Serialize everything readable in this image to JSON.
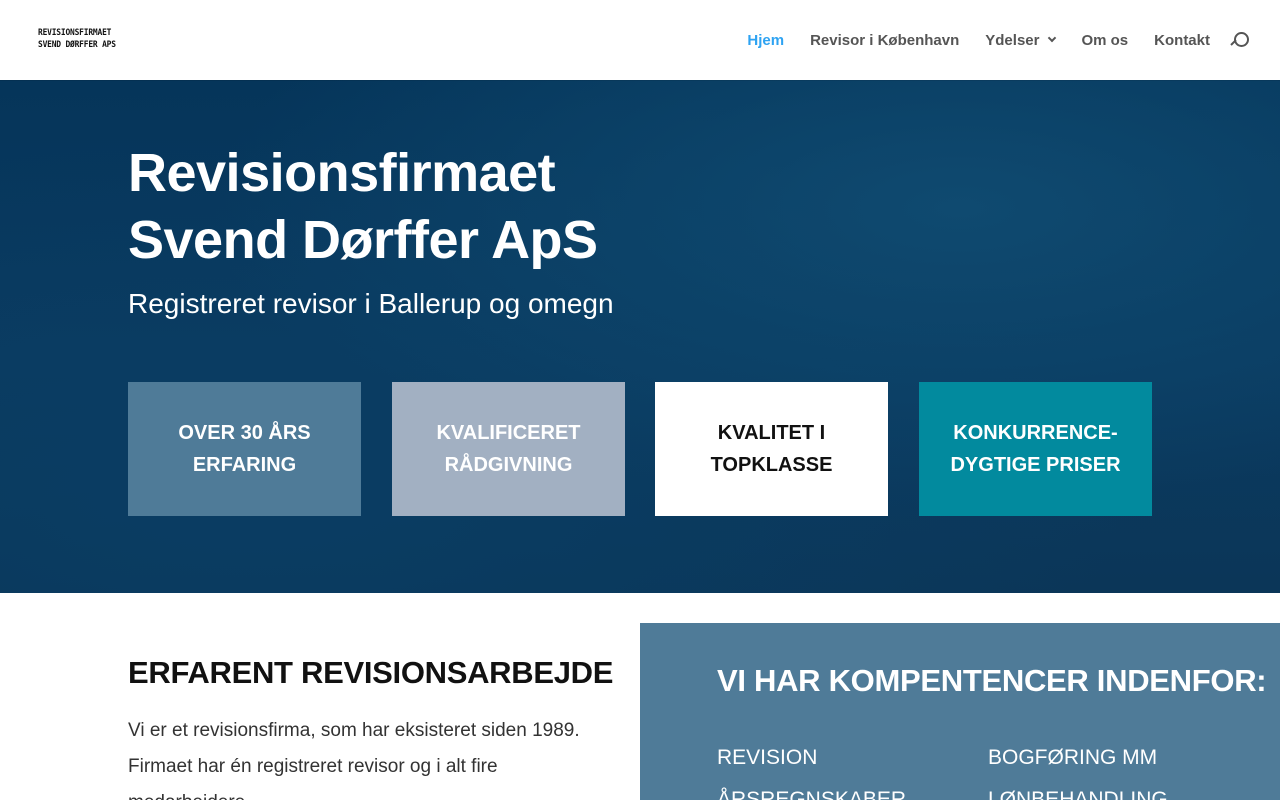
{
  "logo": {
    "line1": "REVISIONSFIRMAET",
    "line2": "SVEND DØRFFER APS"
  },
  "nav": {
    "items": [
      {
        "label": "Hjem"
      },
      {
        "label": "Revisor i København"
      },
      {
        "label": "Ydelser"
      },
      {
        "label": "Om os"
      },
      {
        "label": "Kontakt"
      }
    ]
  },
  "hero": {
    "title_line1": "Revisionsfirmaet",
    "title_line2": "Svend Dørffer ApS",
    "subtitle": "Registreret revisor i Ballerup og omegn",
    "features": [
      {
        "line1": "OVER 30 ÅRS",
        "line2": "ERFARING"
      },
      {
        "line1": "KVALIFICERET",
        "line2": "RÅDGIVNING"
      },
      {
        "line1": "KVALITET I",
        "line2": "TOPKLASSE"
      },
      {
        "line1": "KONKURRENCE-",
        "line2": "DYGTIGE PRISER"
      }
    ]
  },
  "about": {
    "heading": "ERFARENT REVISIONSARBEJDE",
    "paragraph": "Vi er et revisionsfirma, som har eksisteret siden 1989. Firmaet har én registreret revisor og i alt fire medarbejdere."
  },
  "competencies": {
    "heading": "VI HAR KOMPENTENCER INDENFOR:",
    "items": [
      "REVISION",
      "BOGFØRING MM",
      "ÅRSREGNSKABER",
      "LØNBEHANDLING"
    ]
  },
  "colors": {
    "nav_active": "#2ea3f2",
    "feature1": "#4f7b98",
    "feature2": "#a2b0c2",
    "feature3": "#ffffff",
    "feature4": "#028a9e",
    "panel": "#4f7b98"
  }
}
